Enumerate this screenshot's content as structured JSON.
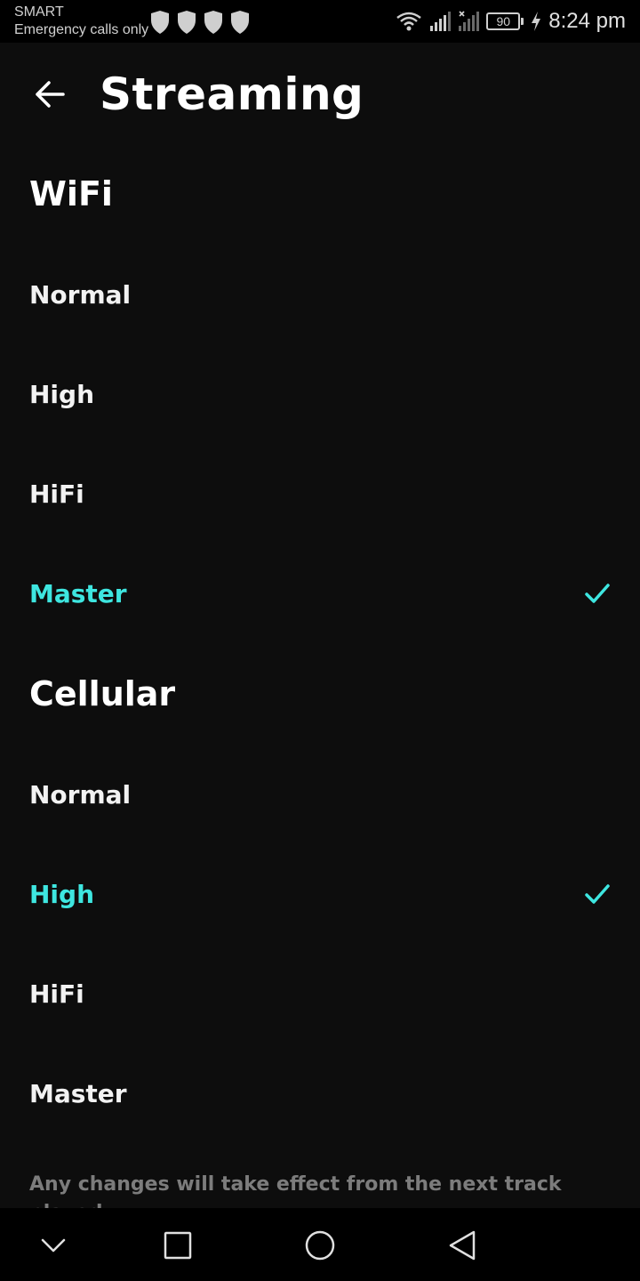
{
  "status_bar": {
    "carrier": "SMART",
    "carrier_status": "Emergency calls only",
    "battery": "90",
    "time": "8:24 pm",
    "icons": [
      "shield-icon",
      "shield-icon",
      "shield-icon",
      "shield-icon",
      "wifi-icon",
      "signal-icon",
      "signal-no-sim-icon",
      "battery-icon",
      "charging-icon"
    ]
  },
  "header": {
    "title": "Streaming",
    "back_icon": "back-arrow-icon"
  },
  "sections": [
    {
      "title": "WiFi",
      "options": [
        {
          "label": "Normal",
          "selected": false
        },
        {
          "label": "High",
          "selected": false
        },
        {
          "label": "HiFi",
          "selected": false
        },
        {
          "label": "Master",
          "selected": true
        }
      ]
    },
    {
      "title": "Cellular",
      "options": [
        {
          "label": "Normal",
          "selected": false
        },
        {
          "label": "High",
          "selected": true
        },
        {
          "label": "HiFi",
          "selected": false
        },
        {
          "label": "Master",
          "selected": false
        }
      ]
    }
  ],
  "note": "Any changes will take effect from the next track played.",
  "colors": {
    "accent": "#3ee6e0",
    "background": "#0d0d0d",
    "muted_text": "#7c7c7c"
  },
  "nav_bar": {
    "icons": [
      "chevron-down-icon",
      "recents-square-icon",
      "home-circle-icon",
      "back-triangle-icon"
    ]
  }
}
